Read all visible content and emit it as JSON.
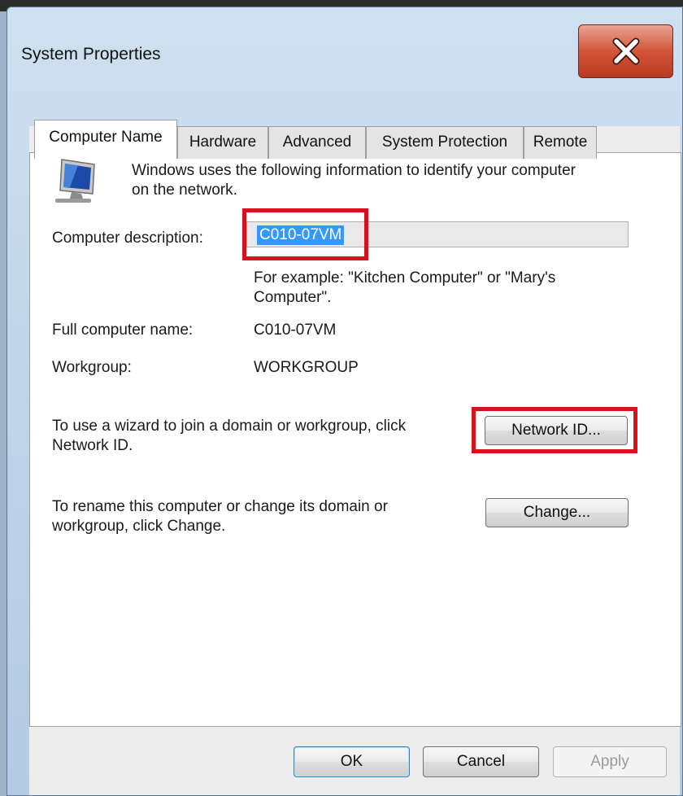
{
  "window": {
    "title": "System Properties"
  },
  "tabs": [
    {
      "label": "Computer Name",
      "active": true
    },
    {
      "label": "Hardware",
      "active": false
    },
    {
      "label": "Advanced",
      "active": false
    },
    {
      "label": "System Protection",
      "active": false
    },
    {
      "label": "Remote",
      "active": false
    }
  ],
  "intro": {
    "line1": "Windows uses the following information to identify your computer",
    "line2": "on the network."
  },
  "description": {
    "label": "Computer description:",
    "value": "C010-07VM",
    "example_line1": "For example: \"Kitchen Computer\" or \"Mary's",
    "example_line2": "Computer\"."
  },
  "full_name": {
    "label": "Full computer name:",
    "value": "C010-07VM"
  },
  "workgroup": {
    "label": "Workgroup:",
    "value": "WORKGROUP"
  },
  "network_id": {
    "text_line1": "To use a wizard to join a domain or workgroup, click",
    "text_line2": "Network ID.",
    "button": "Network ID..."
  },
  "change": {
    "text_line1": "To rename this computer or change its domain or",
    "text_line2": "workgroup, click Change.",
    "button": "Change..."
  },
  "footer": {
    "ok": "OK",
    "cancel": "Cancel",
    "apply": "Apply"
  },
  "colors": {
    "highlight": "#d6121b",
    "selection": "#3399ff",
    "close": "#c7432a"
  },
  "icons": {
    "close": "close-icon",
    "computer": "computer-monitor-icon"
  }
}
